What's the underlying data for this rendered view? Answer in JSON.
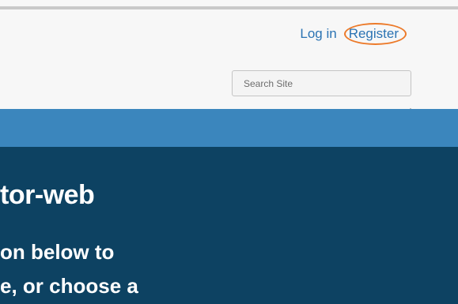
{
  "header": {
    "login_label": "Log in",
    "register_label": "Register",
    "search": {
      "placeholder": "Search Site",
      "value": ""
    }
  },
  "hero": {
    "title": "tor-web",
    "line1": "on below to",
    "line2": "e, or choose a"
  },
  "colors": {
    "link": "#2b73b3",
    "highlight_ring": "#ec7a2a",
    "nav_bar": "#3b86bd",
    "hero_bg": "#0d4262"
  }
}
